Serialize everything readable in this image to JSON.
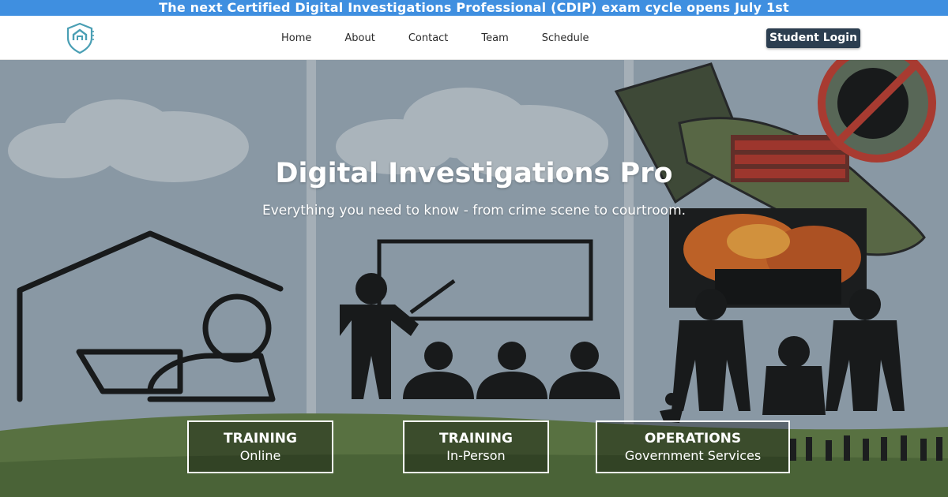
{
  "announcement": "The next Certified Digital Investigations Professional (CDIP) exam cycle opens July 1st",
  "logo": {
    "icon": "shield-house-icon"
  },
  "nav": {
    "items": [
      {
        "label": "Home"
      },
      {
        "label": "About"
      },
      {
        "label": "Contact"
      },
      {
        "label": "Team"
      },
      {
        "label": "Schedule"
      }
    ],
    "login_label": "Student Login"
  },
  "hero": {
    "title": "Digital Investigations Pro",
    "subtitle": "Everything you need to know - from crime scene to courtroom.",
    "icons": [
      "remote-learning-icon",
      "classroom-instructor-icon",
      "bomb-icon",
      "no-terrorist-icon",
      "dynamite-icon",
      "explosion-photo",
      "armed-guards-icon",
      "soldiers-silhouette"
    ]
  },
  "cards": [
    {
      "title": "TRAINING",
      "subtitle": "Online"
    },
    {
      "title": "TRAINING",
      "subtitle": "In-Person"
    },
    {
      "title": "OPERATIONS",
      "subtitle": "Government Services"
    }
  ],
  "colors": {
    "announcement_bg": "#3f8fe0",
    "login_bg": "#2c3e50",
    "logo": "#4a9fb4"
  }
}
